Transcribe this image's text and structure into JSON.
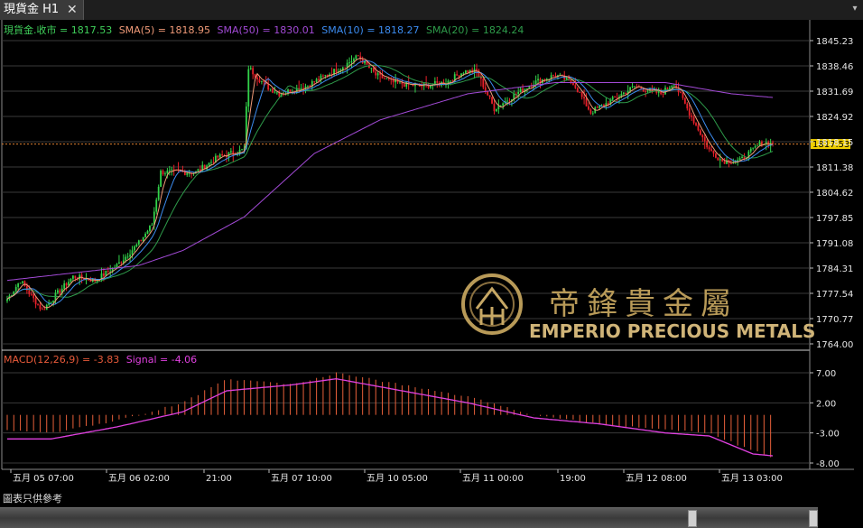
{
  "tab": {
    "title": "現貨金 H1",
    "close_label": "✕"
  },
  "chart_data": {
    "type": "candlestick",
    "symbol_label": "現貨金.收市 = 1817.53",
    "indicators": [
      {
        "label": "SMA(5) = 1818.95",
        "color": "#f09a78"
      },
      {
        "label": "SMA(50) = 1830.01",
        "color": "#a24ad6"
      },
      {
        "label": "SMA(10) = 1818.27",
        "color": "#3c8cf0"
      },
      {
        "label": "SMA(20) = 1824.24",
        "color": "#2e9b4a"
      }
    ],
    "price_axis": [
      "1845.23",
      "1838.46",
      "1831.69",
      "1824.92",
      "1818.15",
      "1811.38",
      "1804.62",
      "1797.85",
      "1791.08",
      "1784.31",
      "1777.54",
      "1770.77",
      "1764.00"
    ],
    "current_price": "1817.53",
    "ylim": [
      1764.0,
      1845.23
    ],
    "macd_label": "MACD(12,26,9) = -3.83",
    "signal_label": "Signal = -4.06",
    "macd_axis": [
      "7.00",
      "2.00",
      "-3.00",
      "-8.00"
    ],
    "macd_ylim": [
      -8.0,
      7.0
    ],
    "x_labels": [
      "五月 05 07:00",
      "五月 06 02:00",
      "21:00",
      "五月 07 10:00",
      "五月 10 05:00",
      "五月 11 00:00",
      "19:00",
      "五月 12 08:00",
      "五月 13 03:00"
    ],
    "close_anchors": [
      [
        0,
        1776
      ],
      [
        6,
        1781
      ],
      [
        12,
        1776
      ],
      [
        16,
        1773
      ],
      [
        22,
        1777
      ],
      [
        30,
        1782
      ],
      [
        40,
        1781
      ],
      [
        50,
        1785
      ],
      [
        60,
        1791
      ],
      [
        66,
        1796
      ],
      [
        70,
        1810
      ],
      [
        76,
        1810
      ],
      [
        86,
        1810
      ],
      [
        96,
        1814
      ],
      [
        108,
        1816
      ],
      [
        110,
        1838
      ],
      [
        118,
        1833
      ],
      [
        124,
        1831
      ],
      [
        136,
        1833
      ],
      [
        152,
        1838
      ],
      [
        160,
        1841
      ],
      [
        168,
        1836
      ],
      [
        176,
        1834
      ],
      [
        188,
        1833
      ],
      [
        200,
        1834
      ],
      [
        208,
        1837
      ],
      [
        214,
        1837
      ],
      [
        222,
        1827
      ],
      [
        232,
        1831
      ],
      [
        240,
        1834
      ],
      [
        250,
        1836
      ],
      [
        258,
        1834
      ],
      [
        266,
        1826
      ],
      [
        272,
        1828
      ],
      [
        286,
        1833
      ],
      [
        298,
        1831
      ],
      [
        304,
        1834
      ],
      [
        310,
        1827
      ],
      [
        320,
        1816
      ],
      [
        326,
        1813
      ],
      [
        334,
        1813
      ],
      [
        344,
        1818
      ],
      [
        349,
        1817.53
      ]
    ],
    "sma50_anchors": [
      [
        0,
        1781
      ],
      [
        30,
        1783
      ],
      [
        60,
        1785
      ],
      [
        80,
        1789
      ],
      [
        108,
        1798
      ],
      [
        140,
        1815
      ],
      [
        170,
        1824
      ],
      [
        210,
        1831
      ],
      [
        250,
        1834
      ],
      [
        300,
        1834
      ],
      [
        330,
        1831
      ],
      [
        349,
        1830
      ]
    ],
    "macd_anchors": [
      [
        0,
        -2.5
      ],
      [
        20,
        -3
      ],
      [
        50,
        -1
      ],
      [
        80,
        2
      ],
      [
        100,
        6
      ],
      [
        130,
        5
      ],
      [
        150,
        7
      ],
      [
        180,
        5
      ],
      [
        210,
        3
      ],
      [
        240,
        0
      ],
      [
        270,
        -1.5
      ],
      [
        300,
        -2.5
      ],
      [
        320,
        -3
      ],
      [
        340,
        -6
      ],
      [
        349,
        -7
      ]
    ],
    "signal_anchors": [
      [
        0,
        -4
      ],
      [
        20,
        -4
      ],
      [
        50,
        -2
      ],
      [
        80,
        0.5
      ],
      [
        100,
        4
      ],
      [
        130,
        5
      ],
      [
        150,
        6
      ],
      [
        180,
        4
      ],
      [
        210,
        2
      ],
      [
        240,
        -0.5
      ],
      [
        270,
        -1.5
      ],
      [
        300,
        -3
      ],
      [
        320,
        -3.5
      ],
      [
        340,
        -6.5
      ],
      [
        349,
        -6.8
      ]
    ]
  },
  "watermark": {
    "chinese_name": "帝鋒貴金屬",
    "english_name": "EMPERIO PRECIOUS METALS"
  },
  "footer": {
    "note": "圖表只供參考"
  }
}
